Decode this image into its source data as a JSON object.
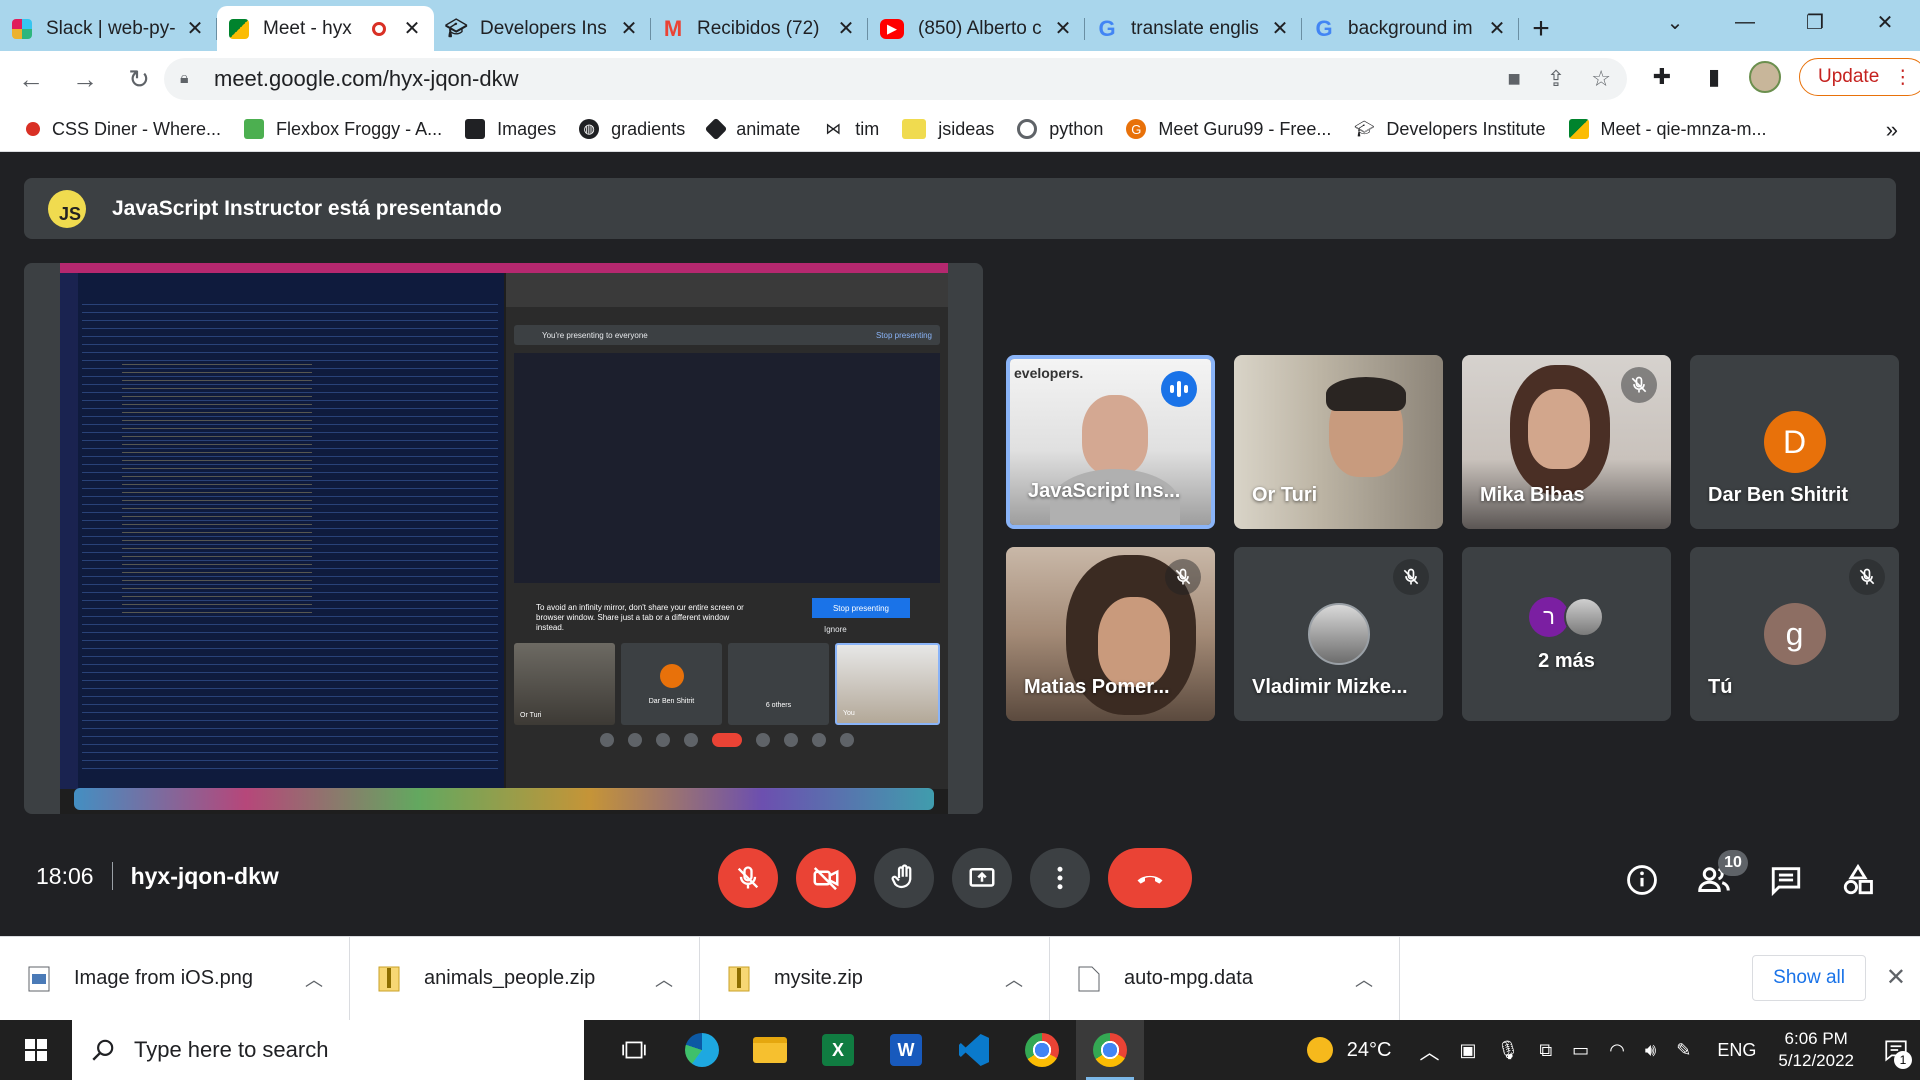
{
  "browser": {
    "tabs": [
      {
        "title": "Slack | web-py-",
        "icon": "slack-icon",
        "color": "#e01e5a"
      },
      {
        "title": "Meet - hyx",
        "icon": "meet-icon",
        "color": "#00832d",
        "active": true
      },
      {
        "title": "Developers Ins",
        "icon": "mortarboard-icon",
        "color": "#202124"
      },
      {
        "title": "Recibidos (72)",
        "icon": "gmail-icon",
        "color": "#ea4335"
      },
      {
        "title": "(850) Alberto c",
        "icon": "youtube-icon",
        "color": "#ff0000"
      },
      {
        "title": "translate englis",
        "icon": "google-icon",
        "color": "#4285f4"
      },
      {
        "title": "background im",
        "icon": "google-icon",
        "color": "#4285f4"
      }
    ],
    "url": "meet.google.com/hyx-jqon-dkw",
    "update_label": "Update",
    "bookmarks": [
      {
        "label": "CSS Diner - Where...",
        "icon": "css-diner-icon",
        "color": "#d93025"
      },
      {
        "label": "Flexbox Froggy - A...",
        "icon": "frog-icon",
        "color": "#4caf50"
      },
      {
        "label": "Images",
        "icon": "images-icon",
        "color": "#202124"
      },
      {
        "label": "gradients",
        "icon": "globe-icon",
        "color": "#202124"
      },
      {
        "label": "animate",
        "icon": "animate-icon",
        "color": "#202124"
      },
      {
        "label": "tim",
        "icon": "bowtie-icon",
        "color": "#202124"
      },
      {
        "label": "jsideas",
        "icon": "jsideas-icon",
        "color": "#f0db4f"
      },
      {
        "label": "python",
        "icon": "python-icon",
        "color": "#5f6368"
      },
      {
        "label": "Meet Guru99 - Free...",
        "icon": "guru99-icon",
        "color": "#e8710a"
      },
      {
        "label": "Developers Institute",
        "icon": "mortarboard-icon",
        "color": "#202124"
      },
      {
        "label": "Meet - qie-mnza-m...",
        "icon": "meet-icon",
        "color": "#00832d"
      }
    ]
  },
  "meet": {
    "presenter_initials": "JS",
    "presenting_text": "JavaScript Instructor está presentando",
    "shared_screen": {
      "banner": "You're presenting to everyone",
      "stop_presenting": "Stop presenting",
      "warning": "To avoid an infinity mirror, don't share your entire screen or browser window. Share just a tab or a different window instead.",
      "stop_button": "Stop presenting",
      "ignore": "Ignore",
      "tiles": [
        "Or Turi",
        "Dar Ben Shitrit",
        "6 others",
        "You"
      ]
    },
    "participants": [
      {
        "name": "JavaScript Ins...",
        "brand": "evelopers.",
        "speaking": true
      },
      {
        "name": "Or Turi"
      },
      {
        "name": "Mika Bibas",
        "muted": true
      },
      {
        "name": "Dar Ben Shitrit",
        "initial": "D",
        "color": "#e8710a"
      },
      {
        "name": "Matias Pomer...",
        "muted": true
      },
      {
        "name": "Vladimir Mizke...",
        "muted": true
      },
      {
        "name": "2 más",
        "initial": "ר",
        "color": "#7b1fa2"
      },
      {
        "name": "Tú",
        "initial": "g",
        "color": "#8d6e63",
        "muted": true
      }
    ],
    "time": "18:06",
    "meeting_code": "hyx-jqon-dkw",
    "participant_count": "10"
  },
  "downloads": {
    "items": [
      "Image from iOS.png",
      "animals_people.zip",
      "mysite.zip",
      "auto-mpg.data"
    ],
    "show_all": "Show all"
  },
  "taskbar": {
    "search_placeholder": "Type here to search",
    "weather": "24°C",
    "language": "ENG",
    "time": "6:06 PM",
    "date": "5/12/2022",
    "notifications": "1"
  }
}
